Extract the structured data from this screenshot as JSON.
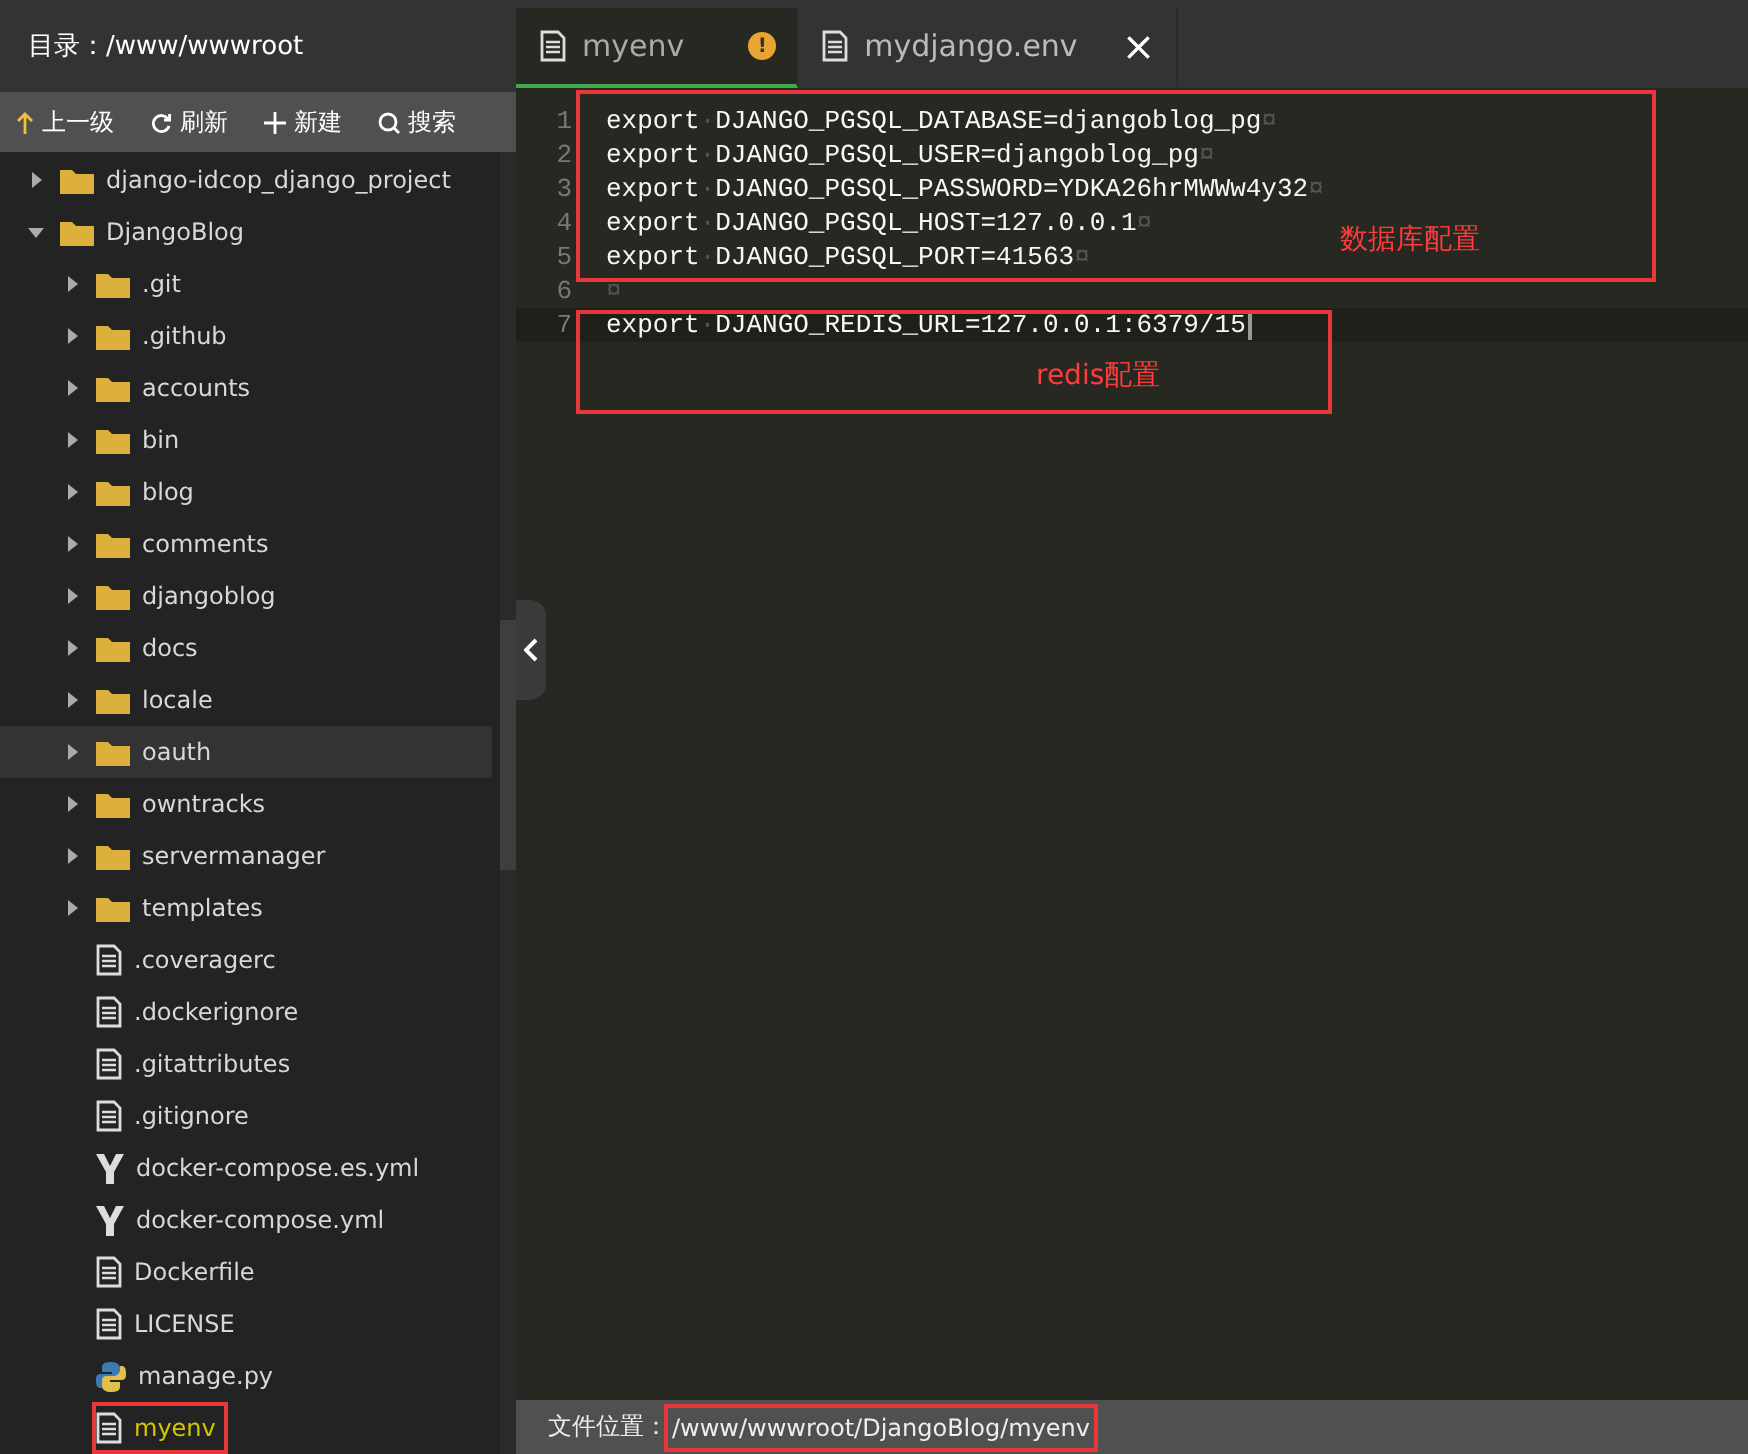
{
  "sidebar": {
    "title": "目录：/www/wwwroot",
    "toolbar": [
      {
        "kind": "up",
        "label": "上一级"
      },
      {
        "kind": "refresh",
        "label": "刷新"
      },
      {
        "kind": "new",
        "label": "新建"
      },
      {
        "kind": "search",
        "label": "搜索"
      }
    ],
    "tree": [
      {
        "kind": "folder",
        "name": "django-idcop_django_project",
        "expanded": false,
        "selected": false,
        "current": false,
        "boxed": false
      },
      {
        "kind": "folder",
        "name": "DjangoBlog",
        "expanded": true,
        "selected": false,
        "current": false,
        "boxed": false,
        "children": [
          {
            "kind": "folder",
            "name": ".git",
            "expanded": false,
            "selected": false,
            "current": false,
            "boxed": false
          },
          {
            "kind": "folder",
            "name": ".github",
            "expanded": false,
            "selected": false,
            "current": false,
            "boxed": false
          },
          {
            "kind": "folder",
            "name": "accounts",
            "expanded": false,
            "selected": false,
            "current": false,
            "boxed": false
          },
          {
            "kind": "folder",
            "name": "bin",
            "expanded": false,
            "selected": false,
            "current": false,
            "boxed": false
          },
          {
            "kind": "folder",
            "name": "blog",
            "expanded": false,
            "selected": false,
            "current": false,
            "boxed": false
          },
          {
            "kind": "folder",
            "name": "comments",
            "expanded": false,
            "selected": false,
            "current": false,
            "boxed": false
          },
          {
            "kind": "folder",
            "name": "djangoblog",
            "expanded": false,
            "selected": false,
            "current": false,
            "boxed": false
          },
          {
            "kind": "folder",
            "name": "docs",
            "expanded": false,
            "selected": false,
            "current": false,
            "boxed": false
          },
          {
            "kind": "folder",
            "name": "locale",
            "expanded": false,
            "selected": false,
            "current": false,
            "boxed": false
          },
          {
            "kind": "folder",
            "name": "oauth",
            "expanded": false,
            "selected": true,
            "current": false,
            "boxed": false
          },
          {
            "kind": "folder",
            "name": "owntracks",
            "expanded": false,
            "selected": false,
            "current": false,
            "boxed": false
          },
          {
            "kind": "folder",
            "name": "servermanager",
            "expanded": false,
            "selected": false,
            "current": false,
            "boxed": false
          },
          {
            "kind": "folder",
            "name": "templates",
            "expanded": false,
            "selected": false,
            "current": false,
            "boxed": false
          },
          {
            "kind": "file",
            "name": ".coveragerc",
            "selected": false,
            "current": false,
            "boxed": false
          },
          {
            "kind": "file",
            "name": ".dockerignore",
            "selected": false,
            "current": false,
            "boxed": false
          },
          {
            "kind": "file",
            "name": ".gitattributes",
            "selected": false,
            "current": false,
            "boxed": false
          },
          {
            "kind": "file",
            "name": ".gitignore",
            "selected": false,
            "current": false,
            "boxed": false
          },
          {
            "kind": "yaml",
            "name": "docker-compose.es.yml",
            "selected": false,
            "current": false,
            "boxed": false
          },
          {
            "kind": "yaml",
            "name": "docker-compose.yml",
            "selected": false,
            "current": false,
            "boxed": false
          },
          {
            "kind": "file",
            "name": "Dockerfile",
            "selected": false,
            "current": false,
            "boxed": false
          },
          {
            "kind": "file",
            "name": "LICENSE",
            "selected": false,
            "current": false,
            "boxed": false
          },
          {
            "kind": "python",
            "name": "manage.py",
            "selected": false,
            "current": false,
            "boxed": false
          },
          {
            "kind": "file",
            "name": "myenv",
            "selected": false,
            "current": true,
            "boxed": true
          }
        ]
      }
    ]
  },
  "tabs": [
    {
      "label": "myenv",
      "selected": true,
      "marker": "!"
    },
    {
      "label": "mydjango.env",
      "selected": false,
      "close": "×"
    }
  ],
  "code": {
    "blocks": [
      {
        "kind": "side",
        "label": "数据库配置",
        "lines": [
          {
            "num": "1",
            "keyword": "export",
            "sep": "·",
            "body": "DJANGO_PGSQL_DATABASE=djangoblog_pg",
            "eol": "¤",
            "current": false
          },
          {
            "num": "2",
            "keyword": "export",
            "sep": "·",
            "body": "DJANGO_PGSQL_USER=djangoblog_pg",
            "eol": "¤",
            "current": false
          },
          {
            "num": "3",
            "keyword": "export",
            "sep": "·",
            "body": "DJANGO_PGSQL_PASSWORD=YDKA26hrMWWw4y32",
            "eol": "¤",
            "current": false
          },
          {
            "num": "4",
            "keyword": "export",
            "sep": "·",
            "body": "DJANGO_PGSQL_HOST=127.0.0.1",
            "eol": "¤",
            "current": false
          },
          {
            "num": "5",
            "keyword": "export",
            "sep": "·",
            "body": "DJANGO_PGSQL_PORT=41563",
            "eol": "¤",
            "current": false
          },
          {
            "num": "6",
            "eol": "¤",
            "current": false
          }
        ]
      },
      {
        "kind": "below",
        "label": "redis配置",
        "lines": [
          {
            "num": "7",
            "keyword": "export",
            "sep": "·",
            "body": "DJANGO_REDIS_URL=127.0.0.1:6379/15",
            "current": true
          }
        ]
      }
    ]
  },
  "status_bar": {
    "label": "文件位置：",
    "path": "/www/wwwroot/DjangoBlog/myenv",
    "boxed": true
  }
}
